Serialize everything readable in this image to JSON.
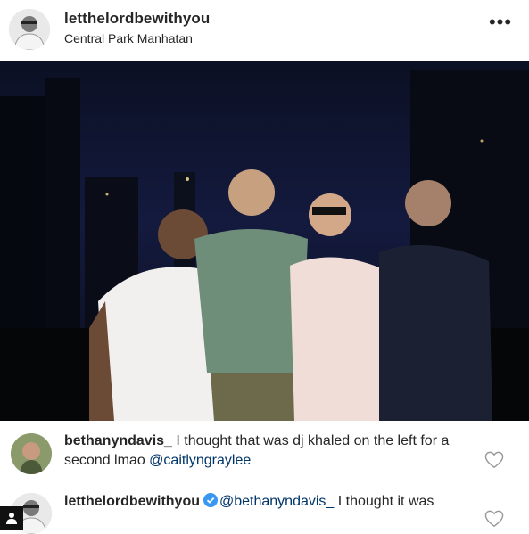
{
  "header": {
    "username": "letthelordbewithyou",
    "location": "Central Park Manhatan",
    "more_label": "•••"
  },
  "photo": {
    "alt": ""
  },
  "comments": [
    {
      "username": "bethanyndavis_",
      "text": " I thought that was dj khaled on the left for a second lmao ",
      "mention": "@caitlyngraylee",
      "liked": false
    },
    {
      "username": "letthelordbewithyou",
      "verified": true,
      "mention": "@bethanyndavis_",
      "text": " I thought it was",
      "liked": false
    }
  ],
  "icons": {
    "more": "more-options-icon",
    "heart": "heart-outline-icon",
    "verified": "verified-badge-icon",
    "profile": "person-icon"
  },
  "colors": {
    "text": "#262626",
    "mention": "#003569",
    "verified": "#3897f0",
    "heart": "#999999"
  }
}
